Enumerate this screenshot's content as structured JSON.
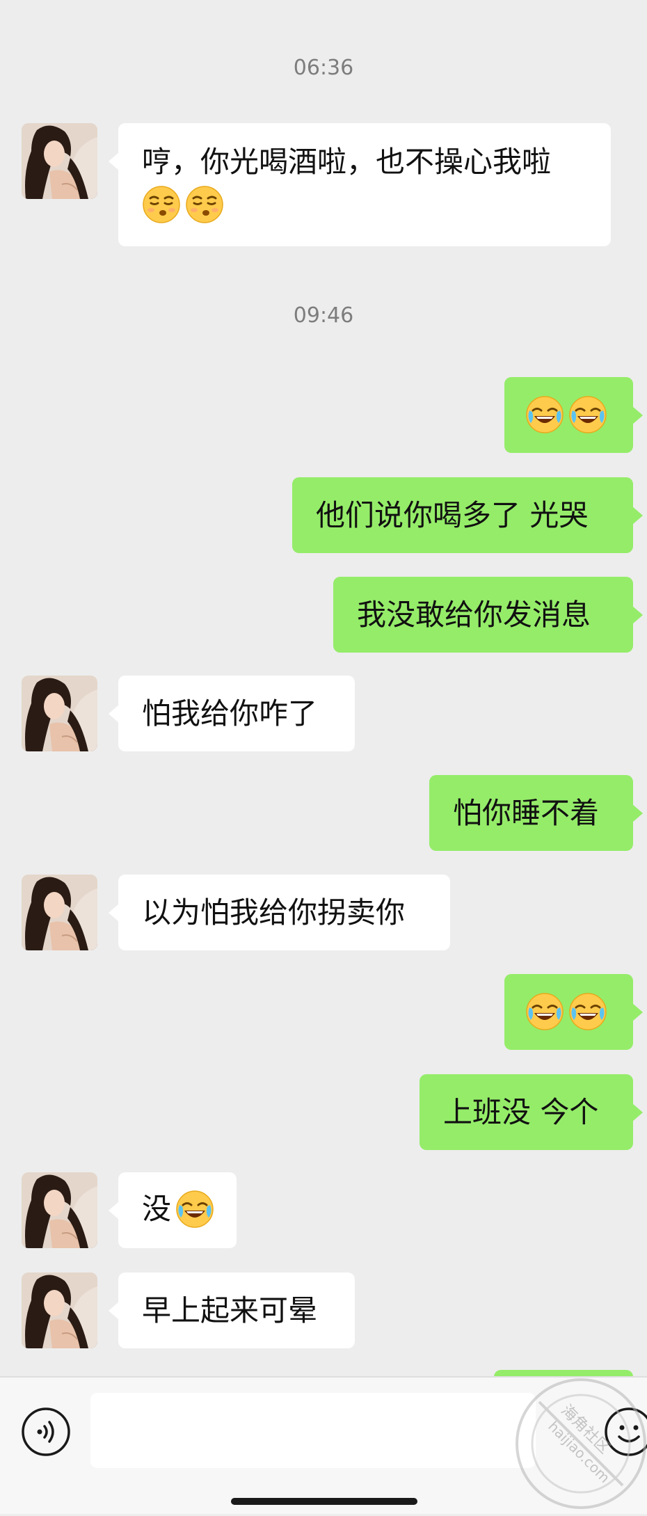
{
  "timestamps": [
    "06:36",
    "09:46"
  ],
  "messages": {
    "m1_text": "哼，你光喝酒啦，也不操心我啦",
    "m2_text": "他们说你喝多了 光哭",
    "m3_text": "我没敢给你发消息",
    "m4_text": "怕我给你咋了",
    "m5_text": "怕你睡不着",
    "m6_text": "以为怕我给你拐卖你",
    "m7_text": "上班没 今个",
    "m8_text": "没",
    "m9_text": "早上起来可晕"
  },
  "emojis": {
    "smirk": "smirk-emoji",
    "laugh_cry": "laugh-cry-emoji"
  },
  "input": {
    "value": "",
    "placeholder": ""
  },
  "watermark": {
    "text_a": "海角社区",
    "text_b": "haijiao.com"
  },
  "colors": {
    "background": "#ededed",
    "incoming_bubble": "#ffffff",
    "outgoing_bubble": "#95ec69",
    "timestamp": "#7d7d7d"
  }
}
